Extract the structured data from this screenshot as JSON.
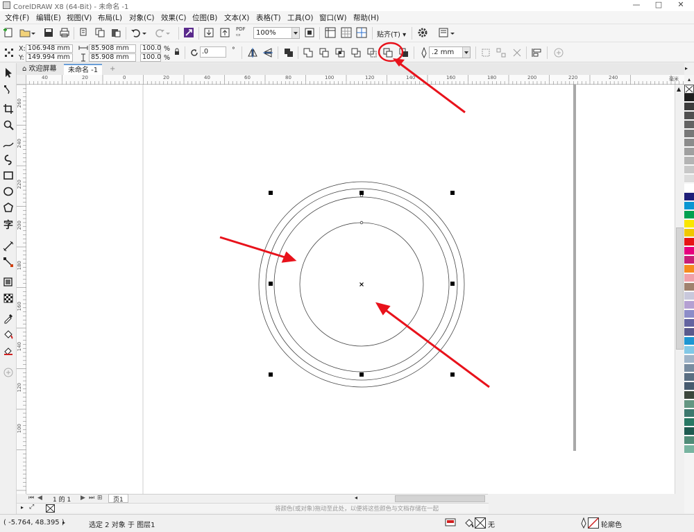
{
  "titlebar": {
    "title": "CorelDRAW X8 (64-Bit) - 未命名 -1",
    "minimize_glyph": "—",
    "restore_glyph": "□",
    "close_glyph": "✕"
  },
  "menu": [
    "文件(F)",
    "编辑(E)",
    "视图(V)",
    "布局(L)",
    "对象(C)",
    "效果(C)",
    "位图(B)",
    "文本(X)",
    "表格(T)",
    "工具(O)",
    "窗口(W)",
    "帮助(H)"
  ],
  "toolbar": {
    "pdf_label": "PDF",
    "zoom_value": "100%",
    "snap_label": "贴齐(T)"
  },
  "property_bar": {
    "x_label": "X:",
    "x_value": "106.948 mm",
    "y_label": "Y:",
    "y_value": "149.994 mm",
    "width_value": "85.908 mm",
    "height_value": "85.908 mm",
    "scale_x": "100.0",
    "scale_y": "100.0",
    "percent": "%",
    "rotation_value": ".0",
    "degree_glyph": "°",
    "outline_width": ".2 mm"
  },
  "doc_tabs": {
    "welcome": "欢迎屏幕",
    "document": "未命名 -1",
    "add": "+"
  },
  "ruler": {
    "top_ticks": [
      "40",
      "20",
      "0",
      "20",
      "40",
      "60",
      "80",
      "100",
      "120",
      "140",
      "160",
      "180",
      "200",
      "220",
      "240"
    ],
    "unit": "毫米",
    "left_ticks": [
      "260",
      "240",
      "220",
      "200",
      "180",
      "160",
      "140",
      "120",
      "100"
    ]
  },
  "page_nav": {
    "page_count": "1 的 1",
    "page_tab": "页1"
  },
  "color_bar_hint": "将颜色(或对象)拖动至此处，以便将这些颜色与文档存储在一起",
  "status": {
    "coordinates": "( -5.764, 48.395 )",
    "selection": "选定 2 对象 于 图层1",
    "fill": "无",
    "outline": "轮廓色"
  },
  "palette_colors": [
    "#1e1e1e",
    "#3c3c3c",
    "#505050",
    "#646464",
    "#787878",
    "#8c8c8c",
    "#a0a0a0",
    "#b4b4b4",
    "#c8c8c8",
    "#dcdcdc",
    "#ffffff",
    "#1e1e78",
    "#0a96d2",
    "#00a050",
    "#fae600",
    "#f0c800",
    "#e61414",
    "#e6007e",
    "#c81e78",
    "#f58c1e",
    "#f0a0aa",
    "#a0826e",
    "#c8c8dc",
    "#b4a0d2",
    "#8c8cc8",
    "#6464a0",
    "#5a5a8c",
    "#1e96d2",
    "#82c8e6",
    "#a0b4c8",
    "#788ca0",
    "#5a6e82",
    "#465a6e",
    "#3c463c",
    "#649682",
    "#3c786e",
    "#287864",
    "#1e5a50",
    "#508c78",
    "#78b4a0"
  ],
  "accent": {
    "annotation_red": "#e8121b"
  }
}
